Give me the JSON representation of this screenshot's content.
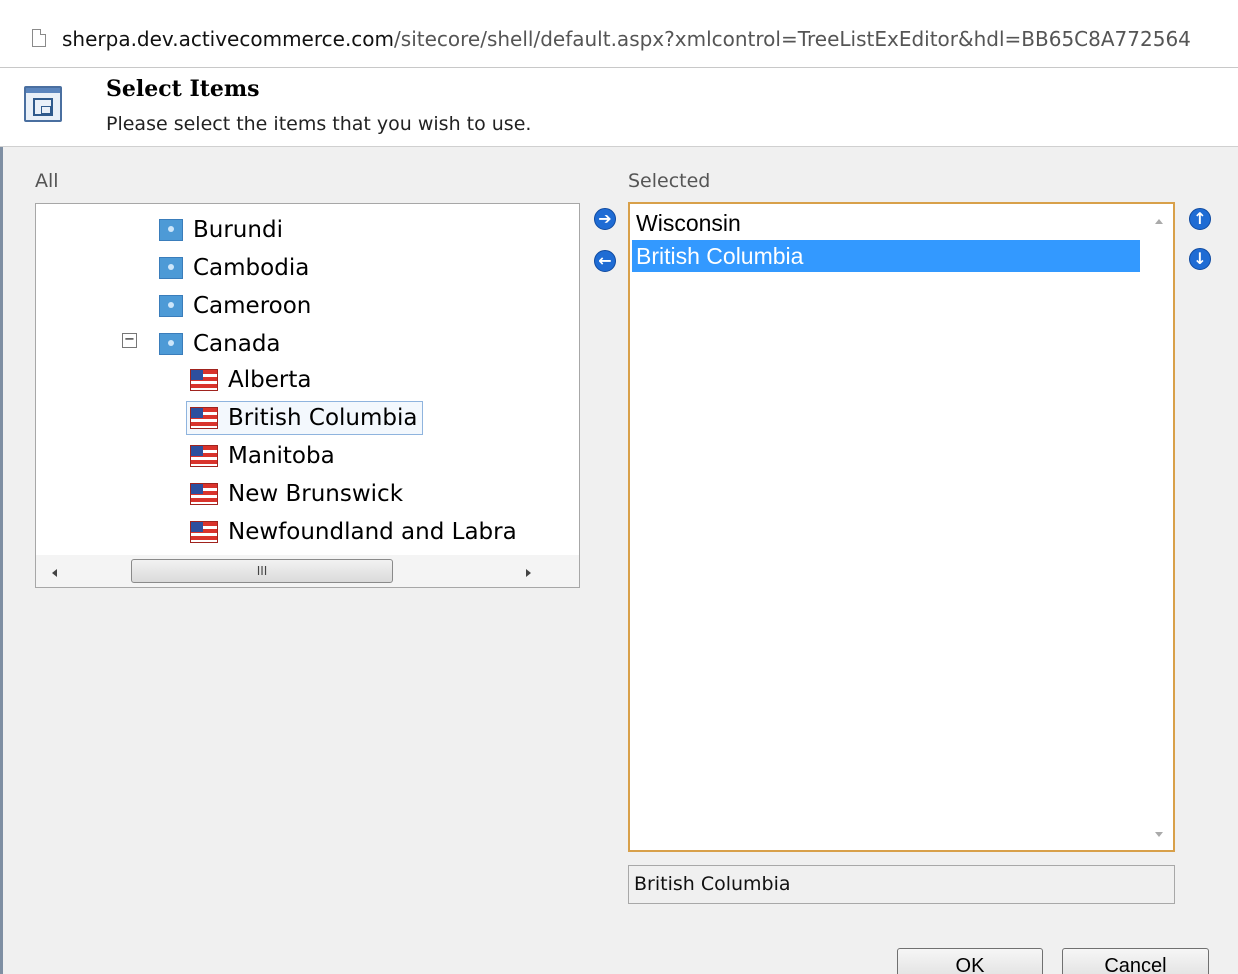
{
  "address_bar": {
    "host": "sherpa.dev.activecommerce.com",
    "path": "/sitecore/shell/default.aspx?xmlcontrol=TreeListExEditor&hdl=BB65C8A772564"
  },
  "header": {
    "title": "Select Items",
    "subtitle": "Please select the items that you wish to use."
  },
  "tree": {
    "label": "All",
    "scroll_thumb_glyph": "III",
    "nodes": [
      {
        "label": "Burundi",
        "icon": "globe-icon"
      },
      {
        "label": "Cambodia",
        "icon": "globe-icon"
      },
      {
        "label": "Cameroon",
        "icon": "globe-icon"
      },
      {
        "label": "Canada",
        "icon": "globe-icon",
        "expanded": true
      },
      {
        "label": "Alberta",
        "icon": "flag-icon"
      },
      {
        "label": "British Columbia",
        "icon": "flag-icon",
        "selected": true
      },
      {
        "label": "Manitoba",
        "icon": "flag-icon"
      },
      {
        "label": "New Brunswick",
        "icon": "flag-icon"
      },
      {
        "label": "Newfoundland and Labra",
        "icon": "flag-icon"
      }
    ]
  },
  "selected": {
    "label": "Selected",
    "items": [
      {
        "label": "Wisconsin"
      },
      {
        "label": "British Columbia",
        "highlighted": true
      }
    ],
    "detail": "British Columbia"
  },
  "buttons": {
    "ok": "OK",
    "cancel": "Cancel"
  },
  "colors": {
    "selection": "#3399ff",
    "list_border": "#d8a04a",
    "arrow_button": "#1f6cd4"
  }
}
